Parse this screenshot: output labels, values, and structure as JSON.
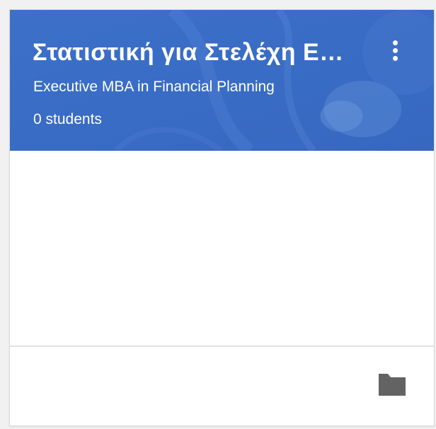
{
  "card": {
    "title": "Στατιστική για Στελέχη Επιχειρήσεων",
    "subtitle": "Executive MBA in Financial Planning",
    "students": "0 students",
    "header_color": "#3a6fc8",
    "menu_icon": "more-vert-icon",
    "folder_icon": "folder-icon",
    "folder_color": "#636363"
  }
}
